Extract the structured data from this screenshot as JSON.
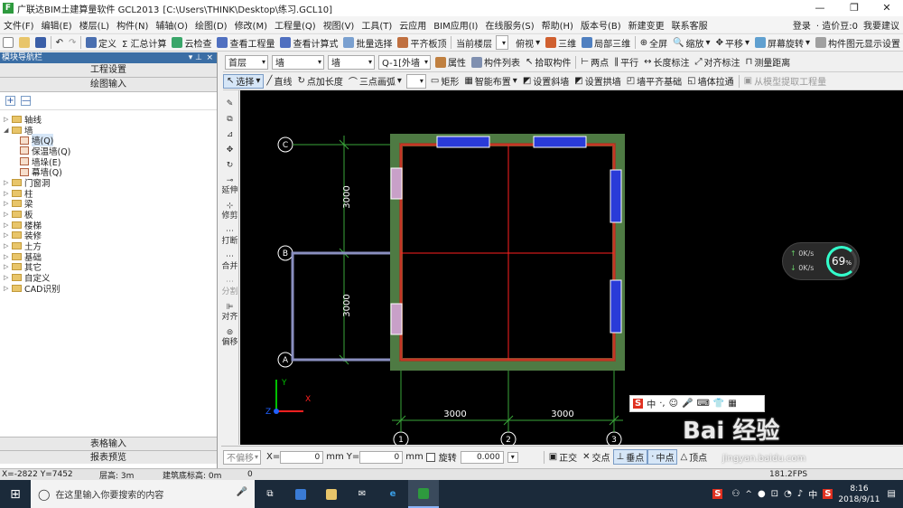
{
  "title": {
    "app_name": "广联达BIM土建算量软件 GCL2013",
    "path": "[C:\\Users\\THINK\\Desktop\\练习.GCL10]",
    "minimize": "—",
    "maximize": "❐",
    "close": "✕"
  },
  "menu": {
    "items": [
      "文件(F)",
      "编辑(E)",
      "楼层(L)",
      "构件(N)",
      "辅轴(O)",
      "绘图(D)",
      "修改(M)",
      "工程量(Q)",
      "视图(V)",
      "工具(T)",
      "云应用",
      "BIM应用(I)",
      "在线服务(S)",
      "帮助(H)",
      "版本号(B)",
      "新建变更",
      "联系客服"
    ],
    "right": [
      "登录",
      "· 造价豆:0",
      "我要建议"
    ]
  },
  "toolbar1": {
    "items": [
      "定义",
      "Σ 汇总计算",
      "云检查",
      "查看工程量",
      "查看计算式",
      "批量选择",
      "平齐板顶",
      "当前楼层",
      "俯视",
      "三维",
      "局部三维",
      "全屏",
      "缩放",
      "平移",
      "屏幕旋转",
      "构件图元显示设置"
    ]
  },
  "nav": {
    "header": "模块导航栏",
    "pin": "▾ ⊥",
    "close": "×",
    "tab_project": "工程设置",
    "tab_draw": "绘图输入",
    "expand_btn": "+",
    "collapse_btn": "—",
    "tree": [
      {
        "label": "轴线",
        "level": 0,
        "expanded": false
      },
      {
        "label": "墙",
        "level": 0,
        "expanded": true
      },
      {
        "label": "墙(Q)",
        "level": 1,
        "selected": true
      },
      {
        "label": "保温墙(Q)",
        "level": 1
      },
      {
        "label": "墙垛(E)",
        "level": 1
      },
      {
        "label": "幕墙(Q)",
        "level": 1
      },
      {
        "label": "门窗洞",
        "level": 0
      },
      {
        "label": "柱",
        "level": 0
      },
      {
        "label": "梁",
        "level": 0
      },
      {
        "label": "板",
        "level": 0
      },
      {
        "label": "楼梯",
        "level": 0
      },
      {
        "label": "装修",
        "level": 0
      },
      {
        "label": "土方",
        "level": 0
      },
      {
        "label": "基础",
        "level": 0
      },
      {
        "label": "其它",
        "level": 0
      },
      {
        "label": "自定义",
        "level": 0
      },
      {
        "label": "CAD识别",
        "level": 0
      }
    ],
    "tab_table": "表格输入",
    "tab_report": "报表预览"
  },
  "toolbar2": {
    "floor": "首层",
    "type": "墙",
    "subtype": "墙",
    "component": "Q-1[外墙",
    "items": [
      "属性",
      "构件列表",
      "拾取构件",
      "两点",
      "平行",
      "长度标注",
      "对齐标注",
      "测量距离"
    ]
  },
  "toolbar3": {
    "items": [
      "选择",
      "直线",
      "点加长度",
      "三点画弧",
      "矩形",
      "智能布置",
      "设置斜墙",
      "设置拱墙",
      "墙平齐基础",
      "墙体拉通",
      "从模型提取工程量"
    ]
  },
  "vtools": [
    "延伸",
    "修剪",
    "打断",
    "合并",
    "分割",
    "对齐",
    "偏移"
  ],
  "drawing": {
    "axis_rows": [
      "C",
      "B",
      "A"
    ],
    "axis_cols": [
      "1",
      "2",
      "3"
    ],
    "dims_h": [
      "3000",
      "3000"
    ],
    "dims_v": [
      "3000",
      "3000"
    ],
    "axis_x_label": "X",
    "axis_y_label": "Y",
    "axis_z_label": "Z",
    "wall_color": "#4e7a43",
    "beam_color": "#8b4a2a",
    "axis_color": "#ff2020",
    "dim_color": "#3aa63a",
    "window_color": "#2a3bd8"
  },
  "netwidget": {
    "up": "0K/s",
    "down": "0K/s",
    "percent": "69",
    "percent_sign": "%"
  },
  "ime_bar": {
    "label": "中"
  },
  "coordrow": {
    "offset_label": "不偏移",
    "x_label": "X=",
    "x_value": "0",
    "unit1": "mm",
    "y_label": "Y=",
    "y_value": "0",
    "unit2": "mm",
    "rotate_label": "旋转",
    "rotate_value": "0.000",
    "snap": [
      "正交",
      "交点",
      "垂点",
      "中点",
      "顶点"
    ]
  },
  "statusbar": {
    "coords": "X=-2822  Y=7452",
    "floor_height": "层高: 3m",
    "base_elev": "建筑底标高: 0m",
    "count": "0",
    "fps": "181.2FPS"
  },
  "watermark": {
    "brand": "Bai 经验",
    "url": "jingyan.baidu.com"
  },
  "taskbar": {
    "search_placeholder": "在这里输入你要搜索的内容",
    "time": "8:16",
    "date": "2018/9/11",
    "lang": "中"
  }
}
